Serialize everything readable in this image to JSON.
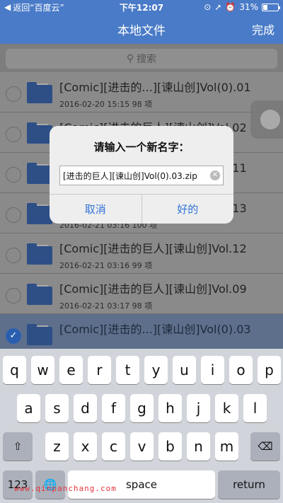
{
  "status": {
    "back_label": "返回“百度云”",
    "time": "下午12:07",
    "battery": "31%",
    "battery_level": 0.31
  },
  "nav": {
    "title": "本地文件",
    "done": "完成"
  },
  "search": {
    "placeholder": "搜索"
  },
  "files": [
    {
      "title": "[Comic][进击的...][谏山创]Vol(0).01",
      "meta": "2016-02-20 15:15  98 项",
      "selected": false
    },
    {
      "title": "[Comic][进击的巨人][谏山创]Vol.02",
      "meta": "",
      "selected": false
    },
    {
      "title": "[Comic][进击的巨人][谏山创]Vol.11",
      "meta": "",
      "selected": false
    },
    {
      "title": "[Comic][进击的巨人][谏山创]Vol.13",
      "meta": "2016-02-21 03:16  100 项",
      "selected": false
    },
    {
      "title": "[Comic][进击的巨人][谏山创]Vol.12",
      "meta": "2016-02-21 03:16  99 项",
      "selected": false
    },
    {
      "title": "[Comic][进击的巨人][谏山创]Vol.09",
      "meta": "2016-02-21 03:17  98 项",
      "selected": false
    },
    {
      "title": "[Comic][进击的...][谏山创]Vol(0).03",
      "meta": "",
      "selected": true
    }
  ],
  "dialog": {
    "title": "请输入一个新名字：",
    "input_value": "[进击的巨人][谏山创]Vol(0).03.zip",
    "cancel": "取消",
    "ok": "好的"
  },
  "keyboard": {
    "row1": [
      "q",
      "w",
      "e",
      "r",
      "t",
      "y",
      "u",
      "i",
      "o",
      "p"
    ],
    "row2": [
      "a",
      "s",
      "d",
      "f",
      "g",
      "h",
      "j",
      "k",
      "l"
    ],
    "row3": [
      "z",
      "x",
      "c",
      "v",
      "b",
      "n",
      "m"
    ],
    "num": "123",
    "space": "space",
    "return": "return"
  },
  "watermark": "www.qinpanchang.com"
}
